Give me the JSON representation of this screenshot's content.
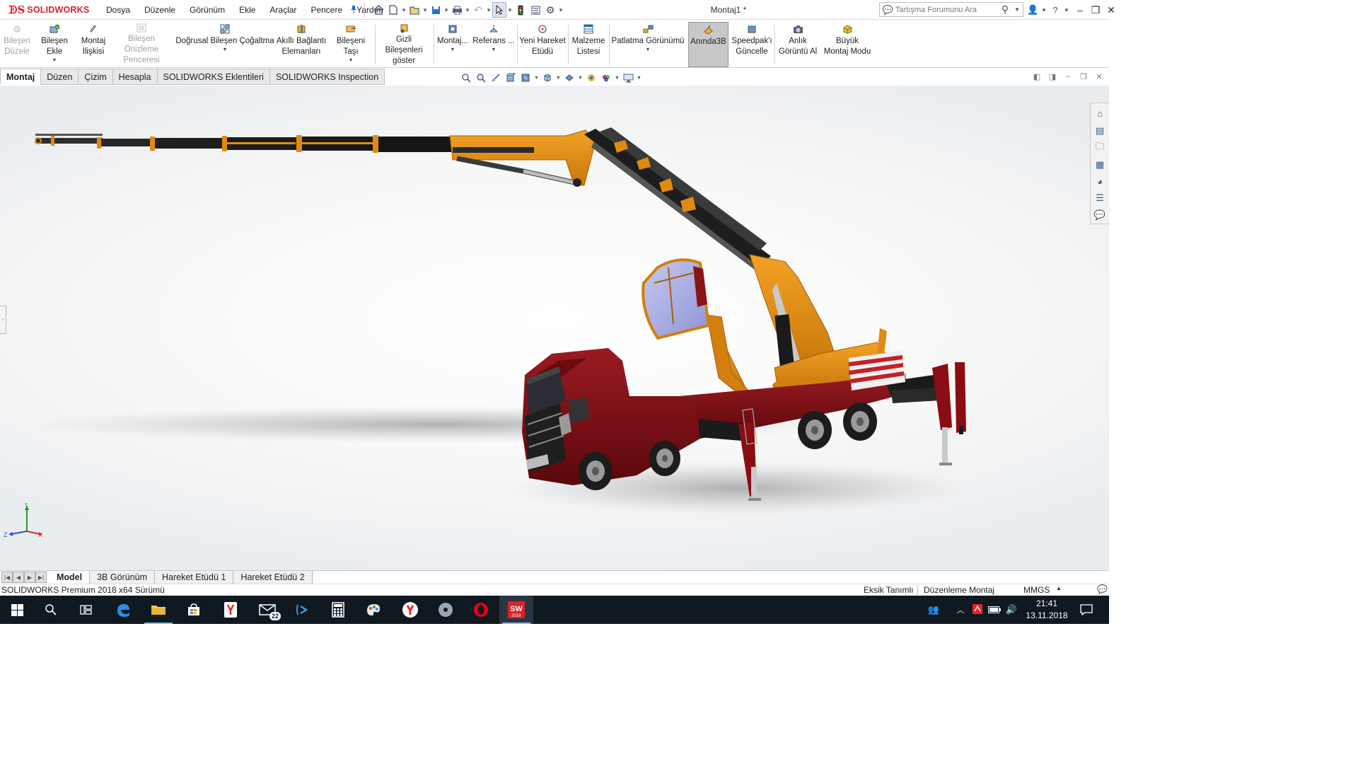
{
  "titlebar": {
    "brand_ds": "ᗫS",
    "brand_name": "SOLIDWORKS",
    "menu": [
      "Dosya",
      "Düzenle",
      "Görünüm",
      "Ekle",
      "Araçlar",
      "Pencere",
      "Yardım"
    ],
    "document_title": "Montaj1 *",
    "search_placeholder": "Tartışma Forumunu Ara"
  },
  "ribbon": {
    "items": [
      {
        "l1": "Bileşen",
        "l2": "Düzele",
        "icon": "edit-component-icon",
        "disabled": true
      },
      {
        "l1": "Bileşen Ekle",
        "l2": "",
        "icon": "insert-component-icon",
        "arrow": true
      },
      {
        "l1": "Montaj",
        "l2": "İlişkisi",
        "icon": "mate-icon"
      },
      {
        "l1": "Bileşen Önizleme",
        "l2": "Penceresi",
        "icon": "component-preview-icon",
        "disabled": true
      },
      {
        "l1": "Doğrusal Bileşen Çoğaltma",
        "l2": "",
        "icon": "linear-pattern-icon",
        "arrow": true
      },
      {
        "l1": "Akıllı Bağlantı",
        "l2": "Elemanları",
        "icon": "smart-fasteners-icon"
      },
      {
        "l1": "Bileşeni Taşı",
        "l2": "",
        "icon": "move-component-icon",
        "arrow": true
      },
      {
        "l1": "Gizli Bileşenleri",
        "l2": "göster",
        "icon": "show-hidden-icon"
      },
      {
        "l1": "Montaj...",
        "l2": "",
        "icon": "assembly-features-icon",
        "arrow": true
      },
      {
        "l1": "Referans ...",
        "l2": "",
        "icon": "reference-geometry-icon",
        "arrow": true
      },
      {
        "l1": "Yeni Hareket",
        "l2": "Etüdü",
        "icon": "motion-study-icon"
      },
      {
        "l1": "Malzeme",
        "l2": "Listesi",
        "icon": "bill-of-materials-icon"
      },
      {
        "l1": "Patlatma Görünümü",
        "l2": "",
        "icon": "exploded-view-icon",
        "arrow": true
      },
      {
        "l1": "Anında3B",
        "l2": "",
        "icon": "instant3d-icon",
        "active": true
      },
      {
        "l1": "Speedpak'ı",
        "l2": "Güncelle",
        "icon": "speedpak-icon"
      },
      {
        "l1": "Anlık",
        "l2": "Görüntü Al",
        "icon": "snapshot-icon"
      },
      {
        "l1": "Büyük",
        "l2": "Montaj Modu",
        "icon": "large-assembly-icon"
      }
    ]
  },
  "cm_tabs": [
    "Montaj",
    "Düzen",
    "Çizim",
    "Hesapla",
    "SOLIDWORKS Eklentileri",
    "SOLIDWORKS Inspection"
  ],
  "bottom_tabs": [
    "Model",
    "3B Görünüm",
    "Hareket Etüdü 1",
    "Hareket Etüdü 2"
  ],
  "status": {
    "version": "SOLIDWORKS Premium 2018 x64 Sürümü",
    "definition": "Eksik Tanımlı",
    "mode": "Düzenleme Montaj",
    "units": "MMGS"
  },
  "triad": {
    "x": "X",
    "y": "Y",
    "z": "Z"
  },
  "taskbar": {
    "mail_badge": "22",
    "time": "21:41",
    "date": "13.11.2018",
    "sw_label": "SW",
    "sw_year": "2018"
  },
  "colors": {
    "brand_red": "#da2128",
    "boom_orange": "#e08a10",
    "truck_red": "#7a0c12",
    "taskbar_bg": "#101820"
  }
}
